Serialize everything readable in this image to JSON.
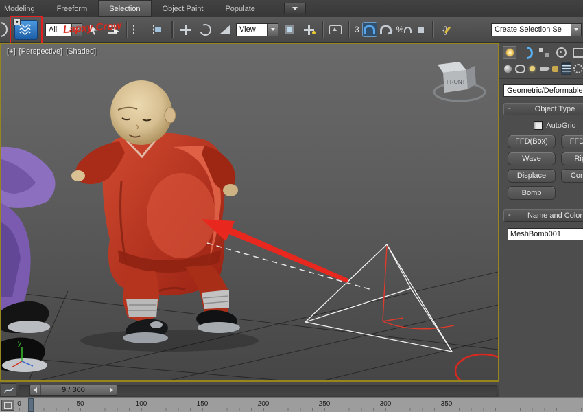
{
  "ribbon": {
    "tabs": [
      "Modeling",
      "Freeform",
      "Selection",
      "Object Paint",
      "Populate"
    ],
    "active_tab": "Selection"
  },
  "toolbar": {
    "selection_filter_value": "All",
    "reference_coordinate_value": "View",
    "selection_set_value": "Create Selection Se",
    "snaps_count_label": "3",
    "percent_snap_label": "%",
    "named_sets_label": "{}"
  },
  "annotation": {
    "toolbar_note": "Lapxy Crow"
  },
  "viewport": {
    "label_general": "[+]",
    "label_pov": "[Perspective]",
    "label_shading": "[Shaded]",
    "viewcube_face_label": "FRONT",
    "axis_label_y": "y"
  },
  "command_panel": {
    "category_dropdown_value": "Geometric/Deformable",
    "object_type": {
      "title": "Object Type",
      "autogrid_label": "AutoGrid",
      "buttons": [
        "FFD(Box)",
        "FFD(Cyl)",
        "Wave",
        "Ripple",
        "Displace",
        "Conform",
        "Bomb"
      ]
    },
    "name_and_color": {
      "title": "Name and Color",
      "object_name": "MeshBomb001"
    }
  },
  "timeline": {
    "frame_display": "9 / 360",
    "ticks": [
      "0",
      "50",
      "100",
      "150",
      "200",
      "250",
      "300",
      "350"
    ]
  },
  "ui": {
    "collapse_glyph": "-"
  },
  "colors": {
    "annotation_red": "#e31f1f",
    "active_viewport_border": "#97851e",
    "bind_icon_blue": "#2f74b8",
    "snap_active_blue": "#56a7ee"
  }
}
